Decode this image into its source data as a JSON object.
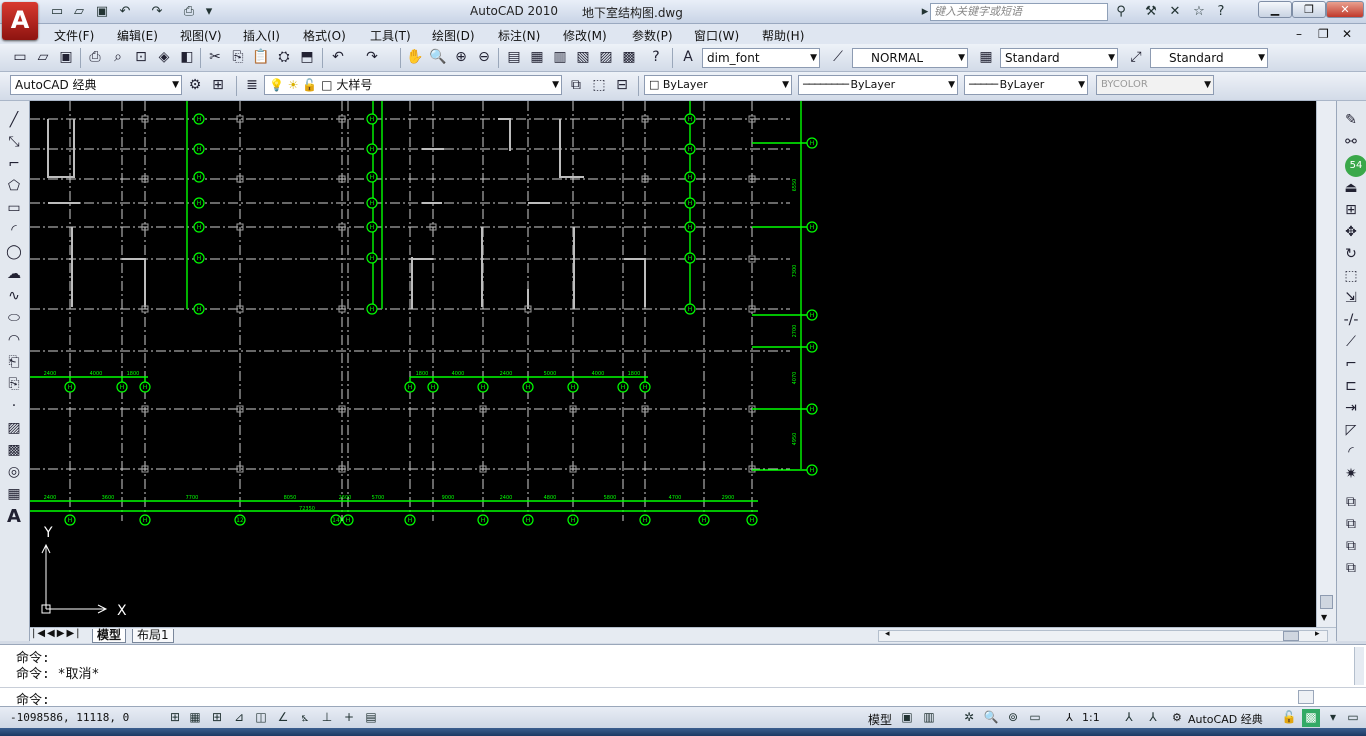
{
  "window": {
    "app_title": "AutoCAD 2010",
    "file_name": "地下室结构图.dwg",
    "search_placeholder": "键入关键字或短语",
    "logo_letter": "A"
  },
  "menu": [
    "文件(F)",
    "编辑(E)",
    "视图(V)",
    "插入(I)",
    "格式(O)",
    "工具(T)",
    "绘图(D)",
    "标注(N)",
    "修改(M)",
    "参数(P)",
    "窗口(W)",
    "帮助(H)"
  ],
  "styles_toolbar": {
    "text_style": "dim_font",
    "dim_style": "NORMAL",
    "table_style": "Standard",
    "multileader_style": "Standard"
  },
  "layers_toolbar": {
    "workspace": "AutoCAD 经典",
    "current_layer": "大样号",
    "color": "ByLayer",
    "linetype": "ByLayer",
    "lineweight": "ByLayer",
    "plot_style": "BYCOLOR"
  },
  "drawing": {
    "ucs_x_label": "X",
    "ucs_y_label": "Y",
    "grid_color": "#00ff00",
    "right_axis_labels": [
      "H",
      "H",
      "H",
      "H",
      "H",
      "H"
    ],
    "right_dims": [
      "6550",
      "7300",
      "2700",
      "4070",
      "4950"
    ],
    "bottom_dims": [
      "2400",
      "3600",
      "7700",
      "8050",
      "2600",
      "5700",
      "9000",
      "2400",
      "4800",
      "5800",
      "4700",
      "2900"
    ],
    "bottom_total": "72350",
    "bottom_axis_labels": [
      "H",
      "H",
      "12",
      "14",
      "H",
      "H",
      "H",
      "H",
      "H",
      "H",
      "H",
      "H"
    ],
    "mid_dims_left": [
      "2400",
      "4000",
      "1800"
    ],
    "mid_dims_right": [
      "1800",
      "4000",
      "2400",
      "5000",
      "4000",
      "1800"
    ],
    "badge": "54"
  },
  "tabs": [
    "模型",
    "布局1"
  ],
  "command": {
    "line1": "命令:",
    "line2": "命令: *取消*",
    "prompt": "命令:"
  },
  "status": {
    "coordinates": "-1098586, 11118, 0",
    "model_label": "模型",
    "annotation_scale": "1:1",
    "workspace_label": "AutoCAD 经典"
  }
}
